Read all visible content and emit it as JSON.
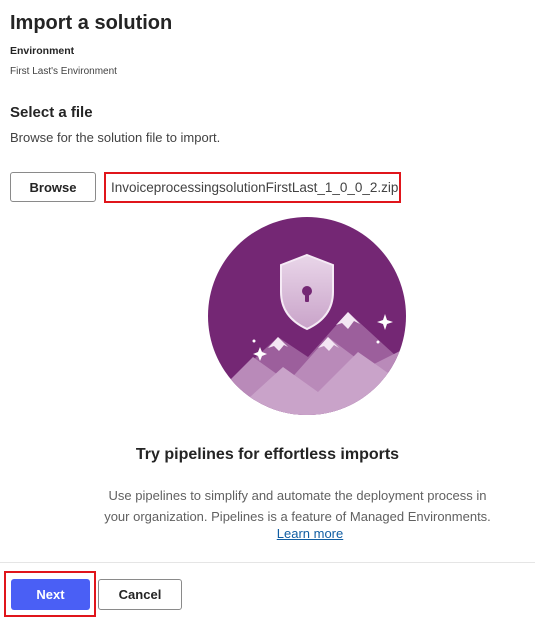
{
  "dialog": {
    "title": "Import a solution",
    "environment_label": "Environment",
    "environment_value": "First Last's Environment"
  },
  "file_section": {
    "title": "Select a file",
    "description": "Browse for the solution file to import.",
    "browse_label": "Browse",
    "file_name": "InvoiceprocessingsolutionFirstLast_1_0_0_2.zip"
  },
  "promo": {
    "illustration_icon": "shield-mountains-illustration",
    "title": "Try pipelines for effortless imports",
    "description_line1": "Use pipelines to simplify and automate the deployment process in",
    "description_line2": "your organization. Pipelines is a feature of Managed Environments.",
    "link_label": "Learn more"
  },
  "footer": {
    "next_label": "Next",
    "cancel_label": "Cancel"
  },
  "colors": {
    "primary_button": "#4a5ff5",
    "highlight_outline": "#e0151b",
    "illustration_purple": "#742774",
    "link": "#115ea3"
  }
}
